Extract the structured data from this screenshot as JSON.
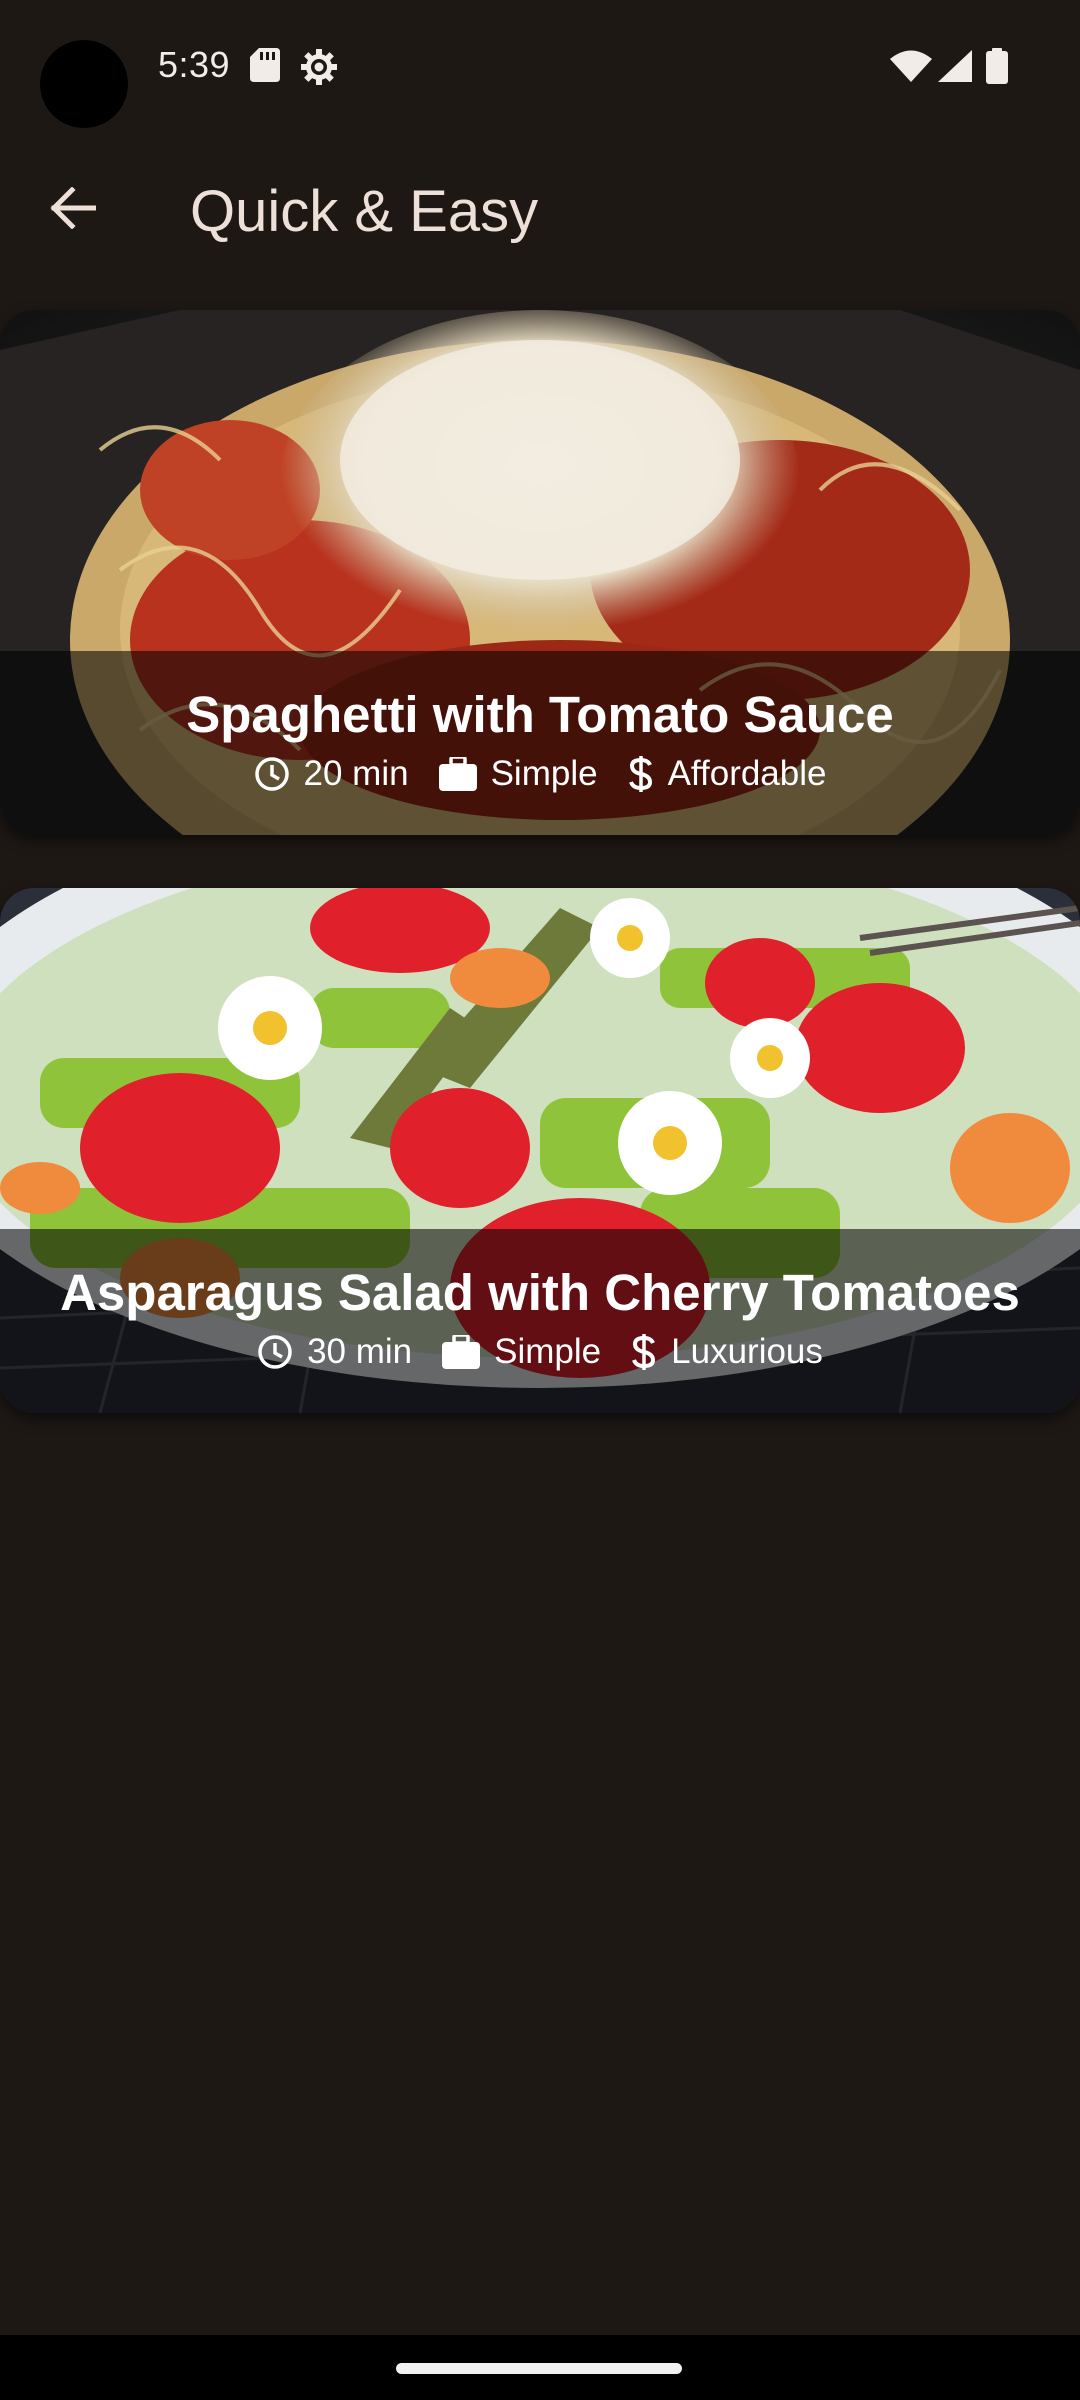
{
  "status_bar": {
    "time": "5:39",
    "icons": [
      "sd-card-icon",
      "gear-icon",
      "wifi-icon",
      "signal-icon",
      "battery-icon"
    ]
  },
  "app_bar": {
    "title": "Quick & Easy",
    "back_icon": "arrow-back-icon"
  },
  "meals": [
    {
      "title": "Spaghetti with Tomato Sauce",
      "duration": "20 min",
      "complexity": "Simple",
      "affordability": "Affordable"
    },
    {
      "title": "Asparagus Salad with Cherry Tomatoes",
      "duration": "30 min",
      "complexity": "Simple",
      "affordability": "Luxurious"
    }
  ],
  "meta_icons": {
    "duration": "clock-icon",
    "complexity": "briefcase-icon",
    "affordability": "dollar-icon"
  },
  "colors": {
    "background": "#1e1815",
    "title_text": "#ece0d8",
    "overlay": "rgba(0,0,0,0.56)"
  }
}
